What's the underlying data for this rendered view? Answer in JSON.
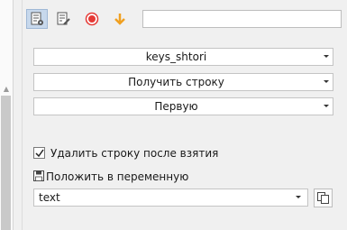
{
  "toolbar": {
    "buttons": [
      {
        "icon": "list-settings-icon"
      },
      {
        "icon": "list-edit-icon"
      },
      {
        "icon": "record-icon",
        "color": "#e53935"
      },
      {
        "icon": "arrow-down-icon",
        "color": "#f0a020"
      }
    ],
    "search_value": ""
  },
  "form": {
    "list_name": "keys_shtori",
    "action": "Получить строку",
    "position": "Первую",
    "delete_after_take": {
      "label": "Удалить строку после взятия",
      "checked": true
    },
    "save_to_variable": {
      "label": "Положить в переменную",
      "value": "text"
    }
  }
}
